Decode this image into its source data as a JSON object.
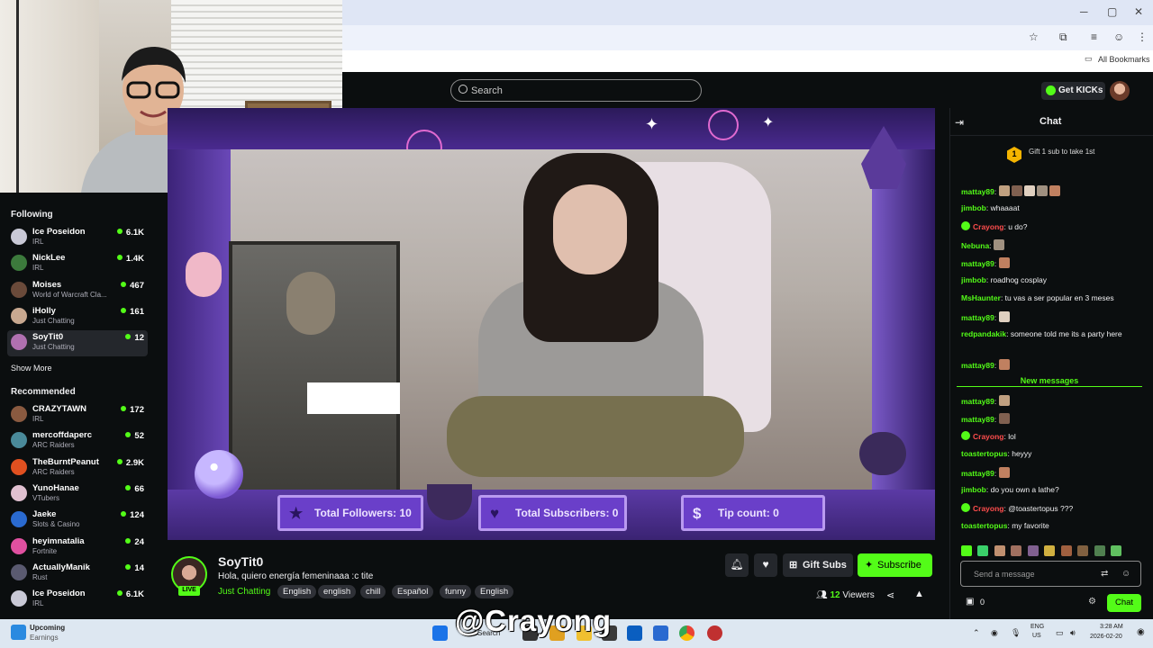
{
  "browser": {
    "bookmarks_label": "All Bookmarks",
    "minimize": "─",
    "maximize": "▢",
    "close": "✕"
  },
  "nav": {
    "search_placeholder": "Search",
    "get_kicks_label": "Get KICKs"
  },
  "sidebar": {
    "following_title": "Following",
    "following": [
      {
        "name": "Ice Poseidon",
        "category": "IRL",
        "count": "6.1K",
        "color": "#c9c9d6"
      },
      {
        "name": "NickLee",
        "category": "IRL",
        "count": "1.4K",
        "color": "#3c7a3c"
      },
      {
        "name": "Moises",
        "category": "World of Warcraft Cla...",
        "count": "467",
        "color": "#6a4a3a"
      },
      {
        "name": "iHolly",
        "category": "Just Chatting",
        "count": "161",
        "color": "#c8a890"
      },
      {
        "name": "SoyTit0",
        "category": "Just Chatting",
        "count": "12",
        "color": "#b070b0"
      }
    ],
    "show_more": "Show More",
    "recommended_title": "Recommended",
    "recommended": [
      {
        "name": "CRAZYTAWN",
        "category": "IRL",
        "count": "172",
        "color": "#8a5a40"
      },
      {
        "name": "mercoffdaperc",
        "category": "ARC Raiders",
        "count": "52",
        "color": "#4a8a9a"
      },
      {
        "name": "TheBurntPeanut",
        "category": "ARC Raiders",
        "count": "2.9K",
        "color": "#e05020"
      },
      {
        "name": "YunoHanae",
        "category": "VTubers",
        "count": "66",
        "color": "#e0c0d0"
      },
      {
        "name": "Jaeke",
        "category": "Slots & Casino",
        "count": "124",
        "color": "#2a6ad0"
      },
      {
        "name": "heyimnatalia",
        "category": "Fortnite",
        "count": "24",
        "color": "#e050a0"
      },
      {
        "name": "ActuallyManik",
        "category": "Rust",
        "count": "14",
        "color": "#5a5a70"
      },
      {
        "name": "Ice Poseidon",
        "category": "IRL",
        "count": "6.1K",
        "color": "#c9c9d6"
      }
    ]
  },
  "overlay": {
    "followers": "Total Followers: 10",
    "subscribers": "Total Subscribers: 0",
    "tips": "Tip count: 0"
  },
  "stream": {
    "streamer": "SoyTit0",
    "live_badge": "LIVE",
    "title": "Hola, quiero energía femeninaaa :c tite",
    "category": "Just Chatting",
    "tags": [
      "English",
      "english",
      "chill",
      "Español",
      "funny",
      "English"
    ],
    "gift_subs": "Gift Subs",
    "subscribe": "Subscribe",
    "viewer_count": "12",
    "viewers_label": "Viewers"
  },
  "chat": {
    "title": "Chat",
    "gift_banner": "Gift 1 sub to take 1st",
    "gift_rank": "1",
    "new_messages": "New messages",
    "messages_before": [
      {
        "user": "mattay89",
        "text": "",
        "color": "#53fc18",
        "emotes": 5
      },
      {
        "user": "jimbob",
        "text": "whaaaat",
        "color": "#53fc18"
      },
      {
        "user": "Crayong",
        "text": "u do?",
        "color": "#ff4d4d",
        "verified": true
      },
      {
        "user": "Nebuna",
        "text": "",
        "color": "#53fc18",
        "emotes": 1
      },
      {
        "user": "mattay89",
        "text": "",
        "color": "#53fc18",
        "emotes": 1
      },
      {
        "user": "jimbob",
        "text": "roadhog cosplay",
        "color": "#53fc18"
      },
      {
        "user": "MsHaunter",
        "text": "tu vas a ser popular en 3 meses",
        "color": "#53fc18"
      },
      {
        "user": "mattay89",
        "text": "",
        "color": "#53fc18",
        "emotes": 1
      },
      {
        "user": "redpandakik",
        "text": "someone told me its a party here",
        "color": "#53fc18"
      },
      {
        "user": "mattay89",
        "text": "",
        "color": "#53fc18",
        "emotes": 1
      }
    ],
    "messages_after": [
      {
        "user": "mattay89",
        "text": "",
        "color": "#53fc18",
        "emotes": 1
      },
      {
        "user": "mattay89",
        "text": "",
        "color": "#53fc18",
        "emotes": 1
      },
      {
        "user": "Crayong",
        "text": "lol",
        "color": "#ff4d4d",
        "verified": true
      },
      {
        "user": "toastertopus",
        "text": "heyyy",
        "color": "#53fc18"
      },
      {
        "user": "mattay89",
        "text": "",
        "color": "#53fc18",
        "emotes": 1
      },
      {
        "user": "jimbob",
        "text": "do you own a lathe?",
        "color": "#53fc18"
      },
      {
        "user": "Crayong",
        "text": "@toastertopus ???",
        "color": "#ff4d4d",
        "verified": true
      },
      {
        "user": "toastertopus",
        "text": "my favorite",
        "color": "#53fc18"
      }
    ],
    "input_placeholder": "Send a message",
    "points": "0",
    "send_label": "Chat"
  },
  "taskbar": {
    "widget_title": "Upcoming",
    "widget_sub": "Earnings",
    "search_label": "Search",
    "lang_top": "ENG",
    "lang_bottom": "US",
    "time": "3:28 AM",
    "date": "2026-02-20"
  },
  "watermark": "@Crayong"
}
